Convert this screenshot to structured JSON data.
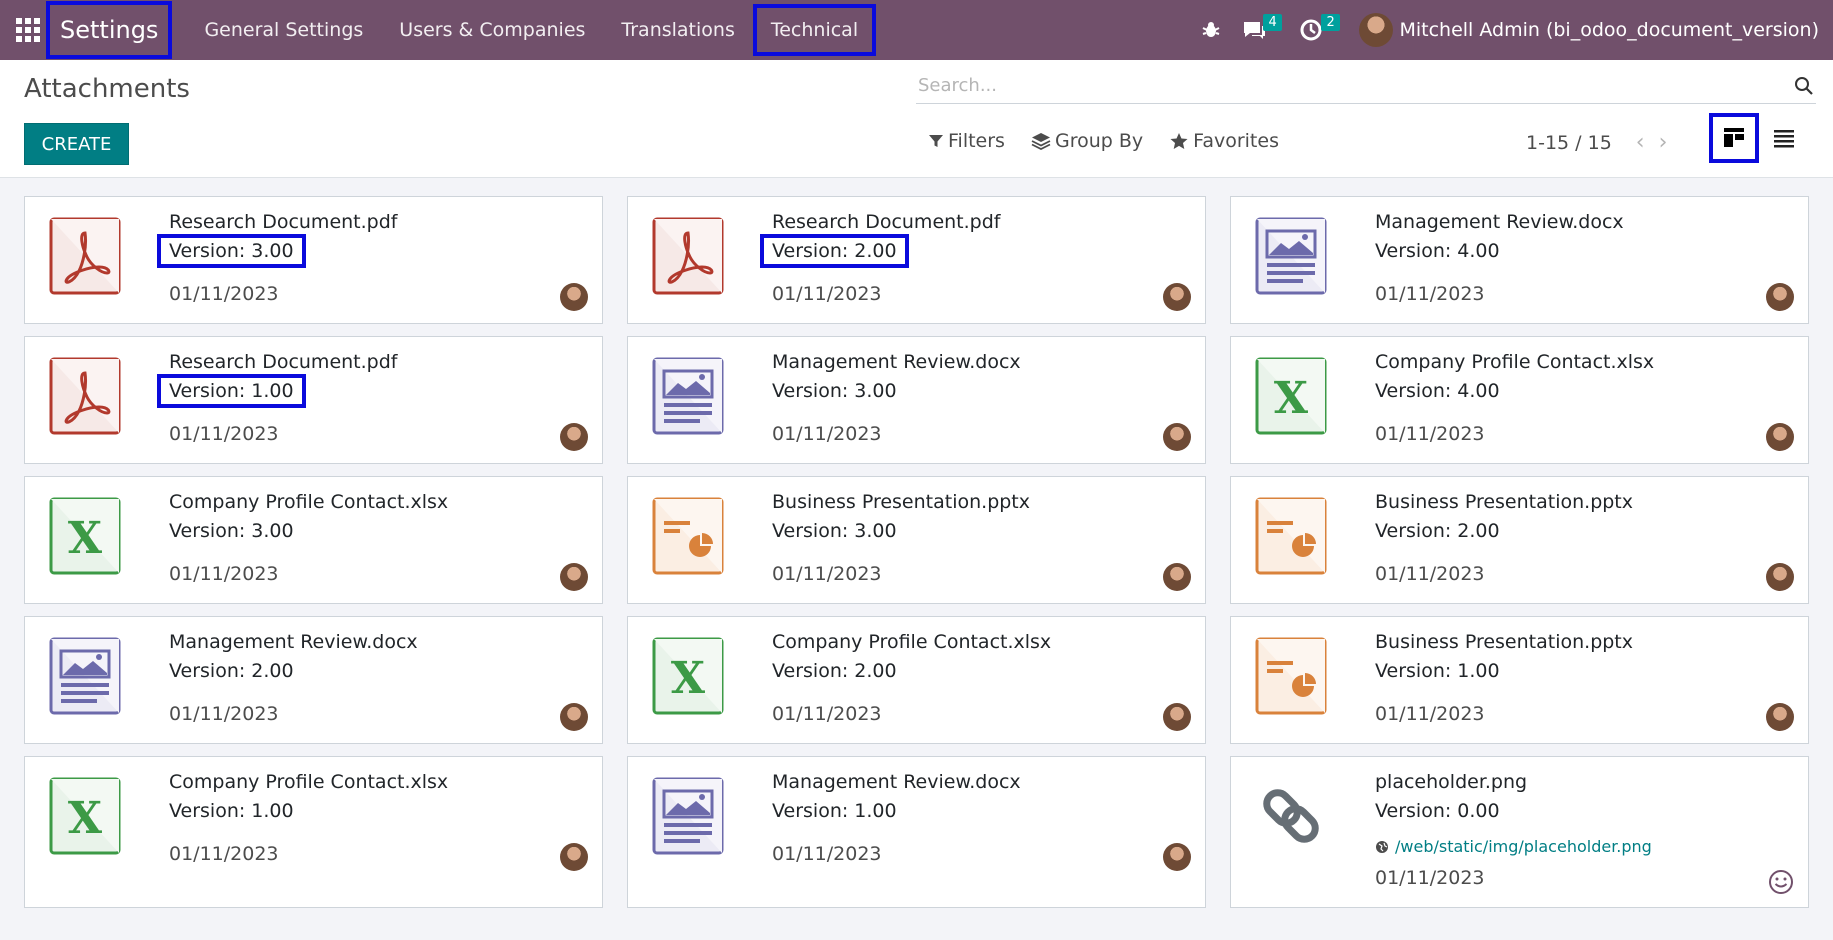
{
  "navbar": {
    "brand": "Settings",
    "menu": [
      "General Settings",
      "Users & Companies",
      "Translations",
      "Technical"
    ],
    "messages_count": "4",
    "activities_count": "2",
    "user": "Mitchell Admin (bi_odoo_document_version)"
  },
  "control_panel": {
    "title": "Attachments",
    "create_label": "CREATE",
    "search_placeholder": "Search...",
    "filters_label": "Filters",
    "groupby_label": "Group By",
    "favorites_label": "Favorites",
    "pager": "1-15 / 15"
  },
  "colors": {
    "navbar": "#71506b",
    "primary": "#017e84",
    "highlight": "#0a0adc"
  },
  "cards": [
    {
      "name": "Research Document.pdf",
      "version": "Version: 3.00",
      "date": "01/11/2023",
      "type": "pdf"
    },
    {
      "name": "Research Document.pdf",
      "version": "Version: 2.00",
      "date": "01/11/2023",
      "type": "pdf"
    },
    {
      "name": "Management Review.docx",
      "version": "Version: 4.00",
      "date": "01/11/2023",
      "type": "doc"
    },
    {
      "name": "Research Document.pdf",
      "version": "Version: 1.00",
      "date": "01/11/2023",
      "type": "pdf"
    },
    {
      "name": "Management Review.docx",
      "version": "Version: 3.00",
      "date": "01/11/2023",
      "type": "doc"
    },
    {
      "name": "Company Profile Contact.xlsx",
      "version": "Version: 4.00",
      "date": "01/11/2023",
      "type": "xls"
    },
    {
      "name": "Company Profile Contact.xlsx",
      "version": "Version: 3.00",
      "date": "01/11/2023",
      "type": "xls"
    },
    {
      "name": "Business Presentation.pptx",
      "version": "Version: 3.00",
      "date": "01/11/2023",
      "type": "ppt"
    },
    {
      "name": "Business Presentation.pptx",
      "version": "Version: 2.00",
      "date": "01/11/2023",
      "type": "ppt"
    },
    {
      "name": "Management Review.docx",
      "version": "Version: 2.00",
      "date": "01/11/2023",
      "type": "doc"
    },
    {
      "name": "Company Profile Contact.xlsx",
      "version": "Version: 2.00",
      "date": "01/11/2023",
      "type": "xls"
    },
    {
      "name": "Business Presentation.pptx",
      "version": "Version: 1.00",
      "date": "01/11/2023",
      "type": "ppt"
    },
    {
      "name": "Company Profile Contact.xlsx",
      "version": "Version: 1.00",
      "date": "01/11/2023",
      "type": "xls"
    },
    {
      "name": "Management Review.docx",
      "version": "Version: 1.00",
      "date": "01/11/2023",
      "type": "doc"
    },
    {
      "name": "placeholder.png",
      "version": "Version: 0.00",
      "date": "01/11/2023",
      "type": "url",
      "url": "/web/static/img/placeholder.png"
    }
  ]
}
